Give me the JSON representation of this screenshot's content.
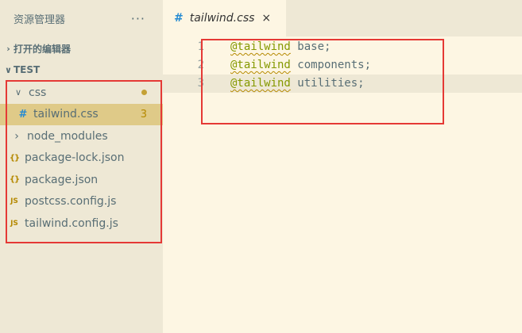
{
  "sidebar": {
    "title": "资源管理器",
    "more": "···",
    "open_editors": "打开的编辑器",
    "workspace": "TEST",
    "files": [
      {
        "name": "css",
        "icon": "chevron-down-icon",
        "glyph": "∨"
      },
      {
        "name": "tailwind.css",
        "icon": "hash-icon",
        "glyph": "#",
        "badge": "3"
      },
      {
        "name": "node_modules",
        "icon": "chevron-right-icon",
        "glyph": "›"
      },
      {
        "name": "package-lock.json",
        "icon": "json-icon",
        "glyph": "{}"
      },
      {
        "name": "package.json",
        "icon": "json-icon",
        "glyph": "{}"
      },
      {
        "name": "postcss.config.js",
        "icon": "js-icon",
        "glyph": "JS"
      },
      {
        "name": "tailwind.config.js",
        "icon": "js-icon",
        "glyph": "JS"
      }
    ]
  },
  "editor": {
    "tab": {
      "label": "tailwind.css",
      "glyph": "#",
      "close": "×"
    },
    "lines": [
      {
        "num": "1",
        "kw": "@tailwind",
        "rest": " base;"
      },
      {
        "num": "2",
        "kw": "@tailwind",
        "rest": " components;"
      },
      {
        "num": "3",
        "kw": "@tailwind",
        "rest": " utilities;"
      }
    ]
  },
  "colors": {
    "sidebar_bg": "#eee8d5",
    "editor_bg": "#fdf6e3",
    "selection": "#dfca88",
    "keyword": "#859900",
    "hash_icon": "#268bd2",
    "annotation": "#e53935"
  }
}
